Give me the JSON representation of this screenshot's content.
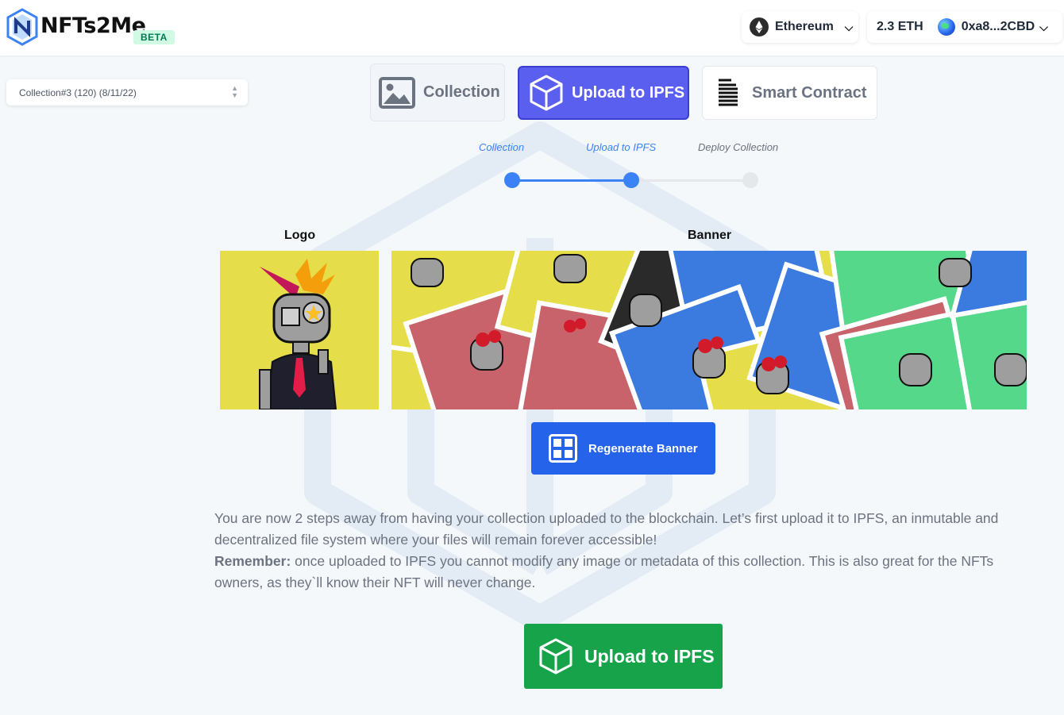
{
  "header": {
    "brand": "NFTs2Me",
    "badge": "BETA",
    "network": "Ethereum",
    "balance": "2.3 ETH",
    "address": "0xa8...2CBD"
  },
  "sidebar": {
    "collection_select": "Collection#3 (120) (8/11/22)"
  },
  "steps": {
    "tabs": [
      {
        "label": "Collection",
        "icon": "image-icon",
        "state": "done"
      },
      {
        "label": "Upload to IPFS",
        "icon": "cube-icon",
        "state": "active"
      },
      {
        "label": "Smart Contract",
        "icon": "contract-icon",
        "state": "pending"
      }
    ],
    "progress": [
      {
        "label": "Collection",
        "done": true
      },
      {
        "label": "Upload to IPFS",
        "done": true
      },
      {
        "label": "Deploy Collection",
        "done": false
      }
    ]
  },
  "images": {
    "logo_label": "Logo",
    "banner_label": "Banner"
  },
  "actions": {
    "regenerate_label": "Regenerate Banner",
    "upload_label": "Upload to IPFS"
  },
  "description": {
    "intro": "You are now 2 steps away from having your collection uploaded to the blockchain. Let’s first upload it to IPFS, an inmutable and decentralized file system where your files will remain forever accessible!",
    "remember_label": "Remember:",
    "remember_text": " once uploaded to IPFS you cannot modify any image or metadata of this collection. This is also great for the NFTs owners, as they`ll know their NFT will never change."
  },
  "colors": {
    "accent": "#3b82f6",
    "active_tab": "#5b5ff0",
    "primary_button": "#2563eb",
    "success_button": "#16a34a",
    "background": "#f5f8fb"
  }
}
